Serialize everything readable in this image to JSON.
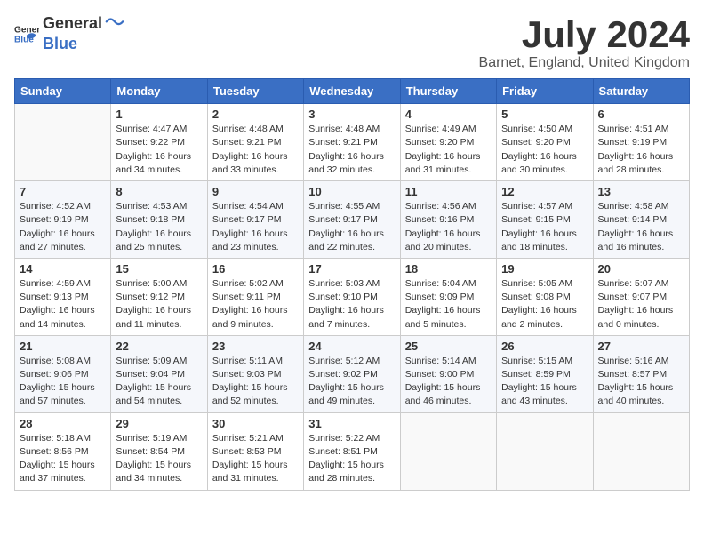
{
  "logo": {
    "general": "General",
    "blue": "Blue"
  },
  "title": {
    "month_year": "July 2024",
    "location": "Barnet, England, United Kingdom"
  },
  "weekdays": [
    "Sunday",
    "Monday",
    "Tuesday",
    "Wednesday",
    "Thursday",
    "Friday",
    "Saturday"
  ],
  "weeks": [
    [
      {
        "day": "",
        "sunrise": "",
        "sunset": "",
        "daylight": ""
      },
      {
        "day": "1",
        "sunrise": "Sunrise: 4:47 AM",
        "sunset": "Sunset: 9:22 PM",
        "daylight": "Daylight: 16 hours and 34 minutes."
      },
      {
        "day": "2",
        "sunrise": "Sunrise: 4:48 AM",
        "sunset": "Sunset: 9:21 PM",
        "daylight": "Daylight: 16 hours and 33 minutes."
      },
      {
        "day": "3",
        "sunrise": "Sunrise: 4:48 AM",
        "sunset": "Sunset: 9:21 PM",
        "daylight": "Daylight: 16 hours and 32 minutes."
      },
      {
        "day": "4",
        "sunrise": "Sunrise: 4:49 AM",
        "sunset": "Sunset: 9:20 PM",
        "daylight": "Daylight: 16 hours and 31 minutes."
      },
      {
        "day": "5",
        "sunrise": "Sunrise: 4:50 AM",
        "sunset": "Sunset: 9:20 PM",
        "daylight": "Daylight: 16 hours and 30 minutes."
      },
      {
        "day": "6",
        "sunrise": "Sunrise: 4:51 AM",
        "sunset": "Sunset: 9:19 PM",
        "daylight": "Daylight: 16 hours and 28 minutes."
      }
    ],
    [
      {
        "day": "7",
        "sunrise": "Sunrise: 4:52 AM",
        "sunset": "Sunset: 9:19 PM",
        "daylight": "Daylight: 16 hours and 27 minutes."
      },
      {
        "day": "8",
        "sunrise": "Sunrise: 4:53 AM",
        "sunset": "Sunset: 9:18 PM",
        "daylight": "Daylight: 16 hours and 25 minutes."
      },
      {
        "day": "9",
        "sunrise": "Sunrise: 4:54 AM",
        "sunset": "Sunset: 9:17 PM",
        "daylight": "Daylight: 16 hours and 23 minutes."
      },
      {
        "day": "10",
        "sunrise": "Sunrise: 4:55 AM",
        "sunset": "Sunset: 9:17 PM",
        "daylight": "Daylight: 16 hours and 22 minutes."
      },
      {
        "day": "11",
        "sunrise": "Sunrise: 4:56 AM",
        "sunset": "Sunset: 9:16 PM",
        "daylight": "Daylight: 16 hours and 20 minutes."
      },
      {
        "day": "12",
        "sunrise": "Sunrise: 4:57 AM",
        "sunset": "Sunset: 9:15 PM",
        "daylight": "Daylight: 16 hours and 18 minutes."
      },
      {
        "day": "13",
        "sunrise": "Sunrise: 4:58 AM",
        "sunset": "Sunset: 9:14 PM",
        "daylight": "Daylight: 16 hours and 16 minutes."
      }
    ],
    [
      {
        "day": "14",
        "sunrise": "Sunrise: 4:59 AM",
        "sunset": "Sunset: 9:13 PM",
        "daylight": "Daylight: 16 hours and 14 minutes."
      },
      {
        "day": "15",
        "sunrise": "Sunrise: 5:00 AM",
        "sunset": "Sunset: 9:12 PM",
        "daylight": "Daylight: 16 hours and 11 minutes."
      },
      {
        "day": "16",
        "sunrise": "Sunrise: 5:02 AM",
        "sunset": "Sunset: 9:11 PM",
        "daylight": "Daylight: 16 hours and 9 minutes."
      },
      {
        "day": "17",
        "sunrise": "Sunrise: 5:03 AM",
        "sunset": "Sunset: 9:10 PM",
        "daylight": "Daylight: 16 hours and 7 minutes."
      },
      {
        "day": "18",
        "sunrise": "Sunrise: 5:04 AM",
        "sunset": "Sunset: 9:09 PM",
        "daylight": "Daylight: 16 hours and 5 minutes."
      },
      {
        "day": "19",
        "sunrise": "Sunrise: 5:05 AM",
        "sunset": "Sunset: 9:08 PM",
        "daylight": "Daylight: 16 hours and 2 minutes."
      },
      {
        "day": "20",
        "sunrise": "Sunrise: 5:07 AM",
        "sunset": "Sunset: 9:07 PM",
        "daylight": "Daylight: 16 hours and 0 minutes."
      }
    ],
    [
      {
        "day": "21",
        "sunrise": "Sunrise: 5:08 AM",
        "sunset": "Sunset: 9:06 PM",
        "daylight": "Daylight: 15 hours and 57 minutes."
      },
      {
        "day": "22",
        "sunrise": "Sunrise: 5:09 AM",
        "sunset": "Sunset: 9:04 PM",
        "daylight": "Daylight: 15 hours and 54 minutes."
      },
      {
        "day": "23",
        "sunrise": "Sunrise: 5:11 AM",
        "sunset": "Sunset: 9:03 PM",
        "daylight": "Daylight: 15 hours and 52 minutes."
      },
      {
        "day": "24",
        "sunrise": "Sunrise: 5:12 AM",
        "sunset": "Sunset: 9:02 PM",
        "daylight": "Daylight: 15 hours and 49 minutes."
      },
      {
        "day": "25",
        "sunrise": "Sunrise: 5:14 AM",
        "sunset": "Sunset: 9:00 PM",
        "daylight": "Daylight: 15 hours and 46 minutes."
      },
      {
        "day": "26",
        "sunrise": "Sunrise: 5:15 AM",
        "sunset": "Sunset: 8:59 PM",
        "daylight": "Daylight: 15 hours and 43 minutes."
      },
      {
        "day": "27",
        "sunrise": "Sunrise: 5:16 AM",
        "sunset": "Sunset: 8:57 PM",
        "daylight": "Daylight: 15 hours and 40 minutes."
      }
    ],
    [
      {
        "day": "28",
        "sunrise": "Sunrise: 5:18 AM",
        "sunset": "Sunset: 8:56 PM",
        "daylight": "Daylight: 15 hours and 37 minutes."
      },
      {
        "day": "29",
        "sunrise": "Sunrise: 5:19 AM",
        "sunset": "Sunset: 8:54 PM",
        "daylight": "Daylight: 15 hours and 34 minutes."
      },
      {
        "day": "30",
        "sunrise": "Sunrise: 5:21 AM",
        "sunset": "Sunset: 8:53 PM",
        "daylight": "Daylight: 15 hours and 31 minutes."
      },
      {
        "day": "31",
        "sunrise": "Sunrise: 5:22 AM",
        "sunset": "Sunset: 8:51 PM",
        "daylight": "Daylight: 15 hours and 28 minutes."
      },
      {
        "day": "",
        "sunrise": "",
        "sunset": "",
        "daylight": ""
      },
      {
        "day": "",
        "sunrise": "",
        "sunset": "",
        "daylight": ""
      },
      {
        "day": "",
        "sunrise": "",
        "sunset": "",
        "daylight": ""
      }
    ]
  ]
}
